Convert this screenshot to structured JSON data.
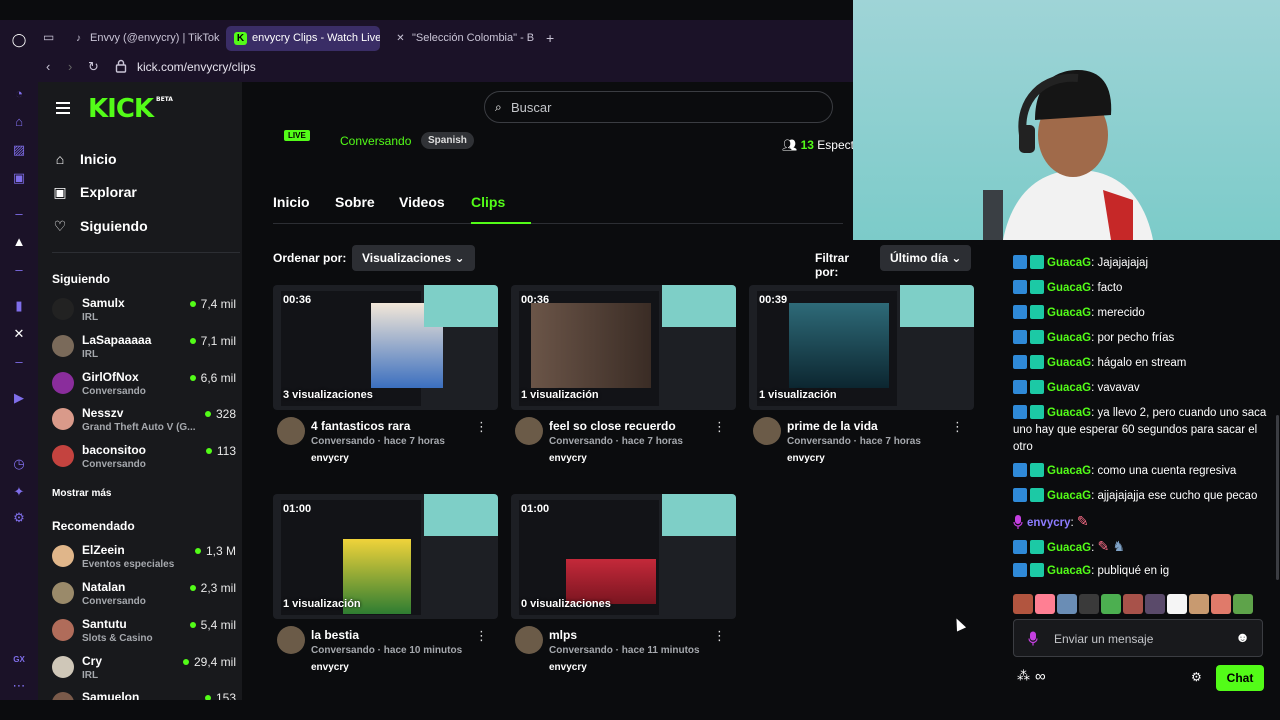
{
  "browser": {
    "tabs": [
      {
        "label": "Envvy (@envycry) | TikTok"
      },
      {
        "label": "envycry Clips - Watch Live"
      },
      {
        "label": "\"Selección Colombia\" - B"
      }
    ],
    "url": "kick.com/envycry/clips"
  },
  "opera_sidebar": {
    "bottom_label": "GX"
  },
  "kick": {
    "logo": "KICK",
    "logo_sup": "BETA",
    "search_placeholder": "Buscar",
    "nav": [
      {
        "label": "Inicio"
      },
      {
        "label": "Explorar"
      },
      {
        "label": "Siguiendo"
      }
    ],
    "following_title": "Siguiendo",
    "following": [
      {
        "name": "Samulx",
        "category": "IRL",
        "viewers": "7,4 mil"
      },
      {
        "name": "LaSapaaaaa",
        "category": "IRL",
        "viewers": "7,1 mil"
      },
      {
        "name": "GirlOfNox",
        "category": "Conversando",
        "viewers": "6,6 mil"
      },
      {
        "name": "Nesszv",
        "category": "Grand Theft Auto V (G...",
        "viewers": "328"
      },
      {
        "name": "baconsitoo",
        "category": "Conversando",
        "viewers": "113"
      }
    ],
    "show_more": "Mostrar más",
    "recommended_title": "Recomendado",
    "recommended": [
      {
        "name": "ElZeein",
        "category": "Eventos especiales",
        "viewers": "1,3 M"
      },
      {
        "name": "Natalan",
        "category": "Conversando",
        "viewers": "2,3 mil"
      },
      {
        "name": "Santutu",
        "category": "Slots & Casino",
        "viewers": "5,4 mil"
      },
      {
        "name": "Cry",
        "category": "IRL",
        "viewers": "29,4 mil"
      },
      {
        "name": "Samuelon",
        "category": "",
        "viewers": "153"
      }
    ]
  },
  "channel": {
    "live_badge": "LIVE",
    "category": "Conversando",
    "language": "Spanish",
    "spectators_count": "13",
    "spectators_label": "Espect",
    "tabs": [
      {
        "label": "Inicio"
      },
      {
        "label": "Sobre"
      },
      {
        "label": "Videos"
      },
      {
        "label": "Clips"
      }
    ],
    "order_label": "Ordenar por:",
    "order_value": "Visualizaciones",
    "filter_label": "Filtrar por:",
    "filter_value": "Último día",
    "clips": [
      {
        "duration": "00:36",
        "views": "3 visualizaciones",
        "title": "4 fantasticos rara",
        "meta": "Conversando · hace 7 horas",
        "user": "envycry"
      },
      {
        "duration": "00:36",
        "views": "1 visualización",
        "title": "feel so close recuerdo",
        "meta": "Conversando · hace 7 horas",
        "user": "envycry"
      },
      {
        "duration": "00:39",
        "views": "1 visualización",
        "title": "prime de la vida",
        "meta": "Conversando · hace 7 horas",
        "user": "envycry"
      },
      {
        "duration": "01:00",
        "views": "1 visualización",
        "title": "la bestia",
        "meta": "Conversando · hace 10 minutos",
        "user": "envycry"
      },
      {
        "duration": "01:00",
        "views": "0 visualizaciones",
        "title": "mlps",
        "meta": "Conversando · hace 11 minutos",
        "user": "envycry"
      }
    ]
  },
  "chat": {
    "messages": [
      {
        "user": "GuacaG",
        "text": ": Jajajajajaj"
      },
      {
        "user": "GuacaG",
        "text": ": facto"
      },
      {
        "user": "GuacaG",
        "text": ": merecido"
      },
      {
        "user": "GuacaG",
        "text": ": por pecho frías"
      },
      {
        "user": "GuacaG",
        "text": ": hágalo en stream"
      },
      {
        "user": "GuacaG",
        "text": ": vavavav"
      },
      {
        "user": "GuacaG",
        "text": ": ya llevo 2, pero cuando uno saca uno hay que esperar 60 segundos para sacar el otro"
      },
      {
        "user": "GuacaG",
        "text": ": como una cuenta regresiva"
      },
      {
        "user": "GuacaG",
        "text": ": ajjajajajja ese cucho que pecao"
      },
      {
        "user": "envycry",
        "text": ":"
      },
      {
        "user": "GuacaG",
        "text": ":"
      },
      {
        "user": "GuacaG",
        "text": ": publiqué en ig"
      }
    ],
    "input_placeholder": "Enviar un mensaje",
    "send_label": "Chat"
  },
  "colors": {
    "kick_green": "#53fc18",
    "opera_purple": "#7f6eea",
    "bg": "#0b0c0e",
    "sidebar": "#18191c"
  }
}
